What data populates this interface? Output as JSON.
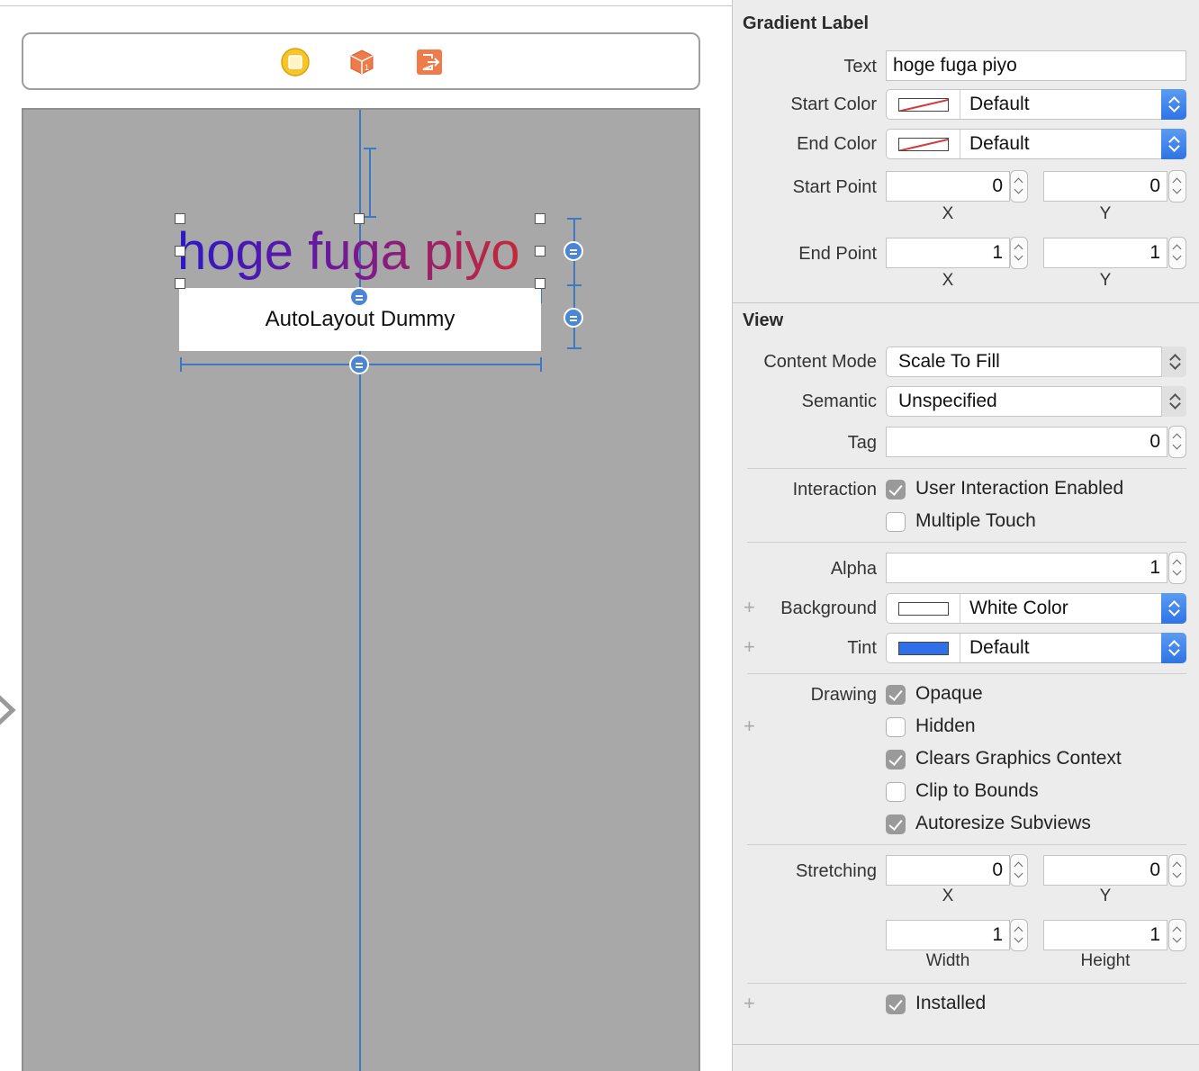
{
  "canvas": {
    "gradient_label_text": "hoge fuga piyo",
    "dummy_view_text": "AutoLayout Dummy"
  },
  "inspector": {
    "gradient_label": {
      "title": "Gradient Label",
      "text_label": "Text",
      "text_value": "hoge fuga piyo",
      "start_color_label": "Start Color",
      "start_color_value": "Default",
      "end_color_label": "End Color",
      "end_color_value": "Default",
      "start_point_label": "Start Point",
      "start_point_x": "0",
      "start_point_y": "0",
      "end_point_label": "End Point",
      "end_point_x": "1",
      "end_point_y": "1",
      "x_label": "X",
      "y_label": "Y"
    },
    "view": {
      "title": "View",
      "content_mode_label": "Content Mode",
      "content_mode_value": "Scale To Fill",
      "semantic_label": "Semantic",
      "semantic_value": "Unspecified",
      "tag_label": "Tag",
      "tag_value": "0",
      "interaction_label": "Interaction",
      "user_interaction_label": "User Interaction Enabled",
      "user_interaction_checked": true,
      "multiple_touch_label": "Multiple Touch",
      "multiple_touch_checked": false,
      "alpha_label": "Alpha",
      "alpha_value": "1",
      "background_label": "Background",
      "background_value": "White Color",
      "tint_label": "Tint",
      "tint_value": "Default",
      "tint_color": "#2f6fe8",
      "drawing_label": "Drawing",
      "opaque_label": "Opaque",
      "opaque_checked": true,
      "hidden_label": "Hidden",
      "hidden_checked": false,
      "clears_graphics_label": "Clears Graphics Context",
      "clears_graphics_checked": true,
      "clip_to_bounds_label": "Clip to Bounds",
      "clip_to_bounds_checked": false,
      "autoresize_label": "Autoresize Subviews",
      "autoresize_checked": true,
      "stretching_label": "Stretching",
      "stretching_x": "0",
      "stretching_y": "0",
      "stretching_width": "1",
      "stretching_height": "1",
      "x_label": "X",
      "y_label": "Y",
      "width_label": "Width",
      "height_label": "Height",
      "installed_label": "Installed",
      "installed_checked": true,
      "plus_symbol": "+"
    }
  }
}
